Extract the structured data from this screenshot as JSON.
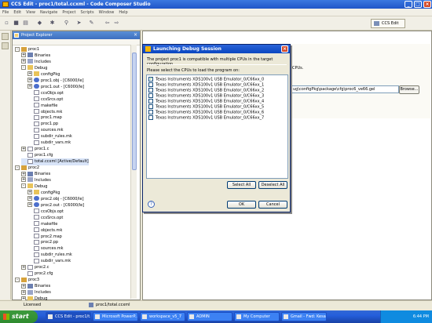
{
  "window": {
    "title": "CCS Edit - proc1/total.ccxml - Code Composer Studio"
  },
  "menu": [
    "File",
    "Edit",
    "View",
    "Navigate",
    "Project",
    "Scripts",
    "Window",
    "Help"
  ],
  "perspective": {
    "label": "CCS Edit"
  },
  "explorer": {
    "title": "Project Explorer",
    "rows": [
      {
        "label": "proc1",
        "icon": "project-icon",
        "toggle": "-"
      },
      {
        "label": "Binaries",
        "icon": "binaries-icon",
        "toggle": "+"
      },
      {
        "label": "Includes",
        "icon": "includes-icon",
        "toggle": "+"
      },
      {
        "label": "Debug",
        "icon": "folder-icon",
        "toggle": "-"
      },
      {
        "label": "configPkg",
        "icon": "folder-icon",
        "toggle": "+"
      },
      {
        "label": "proc1.obj - [C6000/le]",
        "icon": "object-file-icon",
        "toggle": "+"
      },
      {
        "label": "proc1.out - [C6000/le]",
        "icon": "object-file-icon",
        "toggle": "+"
      },
      {
        "label": "ccsObjs.opt",
        "icon": "file-icon"
      },
      {
        "label": "ccsSrcs.opt",
        "icon": "file-icon"
      },
      {
        "label": "makefile",
        "icon": "file-icon"
      },
      {
        "label": "objects.mk",
        "icon": "file-icon"
      },
      {
        "label": "proc1.map",
        "icon": "file-icon"
      },
      {
        "label": "proc1.pp",
        "icon": "file-icon"
      },
      {
        "label": "sources.mk",
        "icon": "file-icon"
      },
      {
        "label": "subdir_rules.mk",
        "icon": "file-icon"
      },
      {
        "label": "subdir_vars.mk",
        "icon": "file-icon"
      },
      {
        "label": "proc1.c",
        "icon": "file-icon",
        "toggle": "+"
      },
      {
        "label": "proc1.cfg",
        "icon": "file-icon"
      },
      {
        "label": "total.ccxml [Active/Default]",
        "icon": "file-icon",
        "selected": true
      },
      {
        "label": "proc2",
        "icon": "project-icon",
        "toggle": "-"
      },
      {
        "label": "Binaries",
        "icon": "binaries-icon",
        "toggle": "+"
      },
      {
        "label": "Includes",
        "icon": "includes-icon",
        "toggle": "+"
      },
      {
        "label": "Debug",
        "icon": "folder-icon",
        "toggle": "-"
      },
      {
        "label": "configPkg",
        "icon": "folder-icon",
        "toggle": "+"
      },
      {
        "label": "proc2.obj - [C6000/le]",
        "icon": "object-file-icon",
        "toggle": "+"
      },
      {
        "label": "proc2.out - [C6000/le]",
        "icon": "object-file-icon",
        "toggle": "+"
      },
      {
        "label": "ccsObjs.opt",
        "icon": "file-icon"
      },
      {
        "label": "ccsSrcs.opt",
        "icon": "file-icon"
      },
      {
        "label": "makefile",
        "icon": "file-icon"
      },
      {
        "label": "objects.mk",
        "icon": "file-icon"
      },
      {
        "label": "proc2.map",
        "icon": "file-icon"
      },
      {
        "label": "proc2.pp",
        "icon": "file-icon"
      },
      {
        "label": "sources.mk",
        "icon": "file-icon"
      },
      {
        "label": "subdir_rules.mk",
        "icon": "file-icon"
      },
      {
        "label": "subdir_vars.mk",
        "icon": "file-icon"
      },
      {
        "label": "proc2.c",
        "icon": "file-icon",
        "toggle": "+"
      },
      {
        "label": "proc2.cfg",
        "icon": "file-icon"
      },
      {
        "label": "proc3",
        "icon": "project-icon",
        "toggle": "-"
      },
      {
        "label": "Binaries",
        "icon": "binaries-icon",
        "toggle": "+"
      },
      {
        "label": "Includes",
        "icon": "includes-icon",
        "toggle": "+"
      },
      {
        "label": "Debug",
        "icon": "folder-icon",
        "toggle": "+"
      }
    ]
  },
  "background": {
    "text": "CPUs.",
    "gel_path": "ug\\configPkg\\package\\cfg\\proc6_ve66.gel",
    "browse_label": "Browse..."
  },
  "dialog": {
    "title": "Launching Debug Session",
    "message": "The project proc1 is compatible with multiple CPUs in the target configuration.",
    "list_label": "Please select the CPUs to load the program on:",
    "cpus": [
      {
        "label": "Texas Instruments XDS100v1 USB Emulator_0/C66xx_0",
        "checked": true
      },
      {
        "label": "Texas Instruments XDS100v1 USB Emulator_0/C66xx_1",
        "checked": false
      },
      {
        "label": "Texas Instruments XDS100v1 USB Emulator_0/C66xx_2",
        "checked": false
      },
      {
        "label": "Texas Instruments XDS100v1 USB Emulator_0/C66xx_3",
        "checked": false
      },
      {
        "label": "Texas Instruments XDS100v1 USB Emulator_0/C66xx_4",
        "checked": false
      },
      {
        "label": "Texas Instruments XDS100v1 USB Emulator_0/C66xx_5",
        "checked": false
      },
      {
        "label": "Texas Instruments XDS100v1 USB Emulator_0/C66xx_6",
        "checked": false
      },
      {
        "label": "Texas Instruments XDS100v1 USB Emulator_0/C66xx_7",
        "checked": false
      }
    ],
    "select_all": "Select All",
    "deselect_all": "Deselect All",
    "ok": "OK",
    "cancel": "Cancel"
  },
  "status": {
    "left": "Licensed",
    "file": "proc1/total.ccxml"
  },
  "taskbar": {
    "start": "start",
    "tasks": [
      "CCS Edit - proc1/t...",
      "Microsoft PowerP...",
      "workspace_v5_7",
      "ADMIN",
      "My Computer",
      "Gmail - Fwd: Kesa..."
    ],
    "clock": "6:44 PM"
  }
}
